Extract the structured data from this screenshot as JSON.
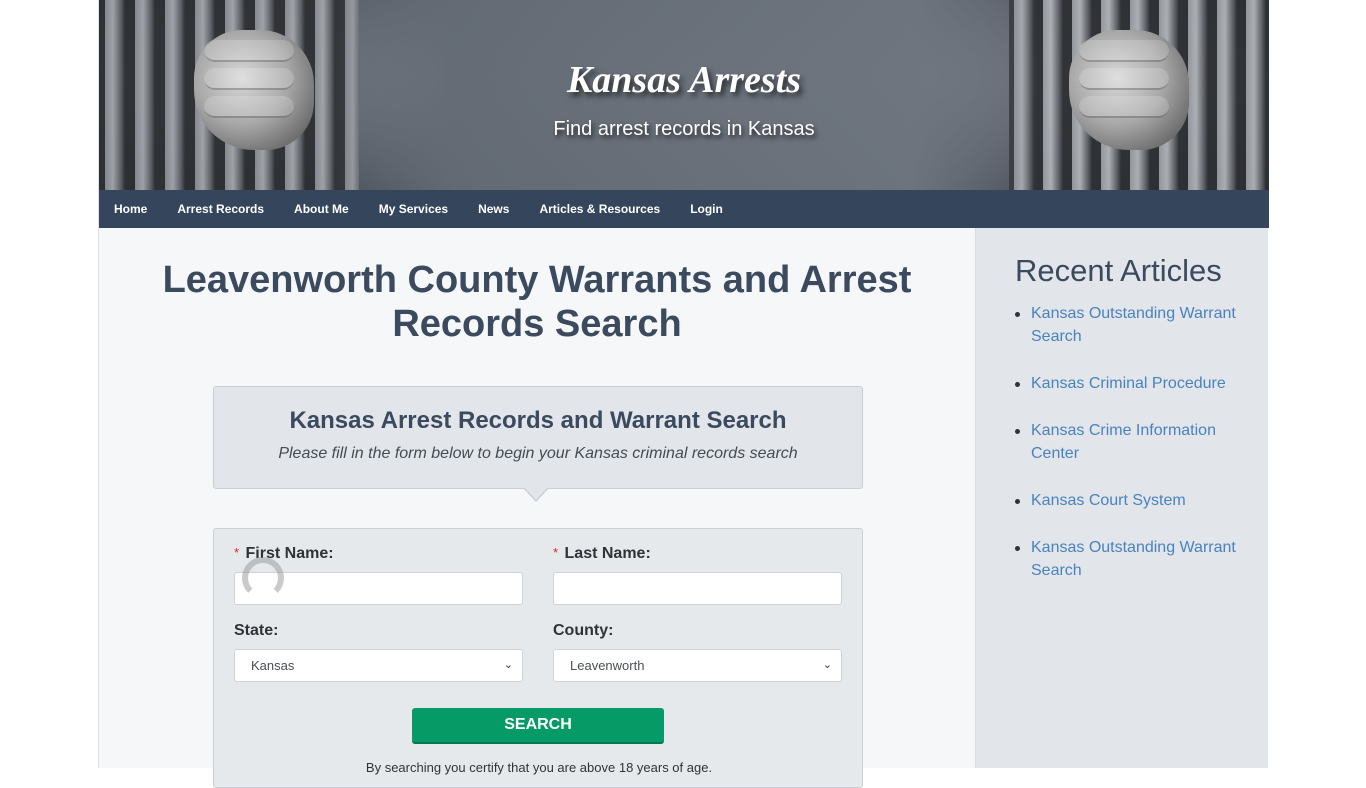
{
  "header": {
    "site_title": "Kansas Arrests",
    "tagline": "Find arrest records in Kansas"
  },
  "nav": {
    "items": [
      {
        "label": "Home"
      },
      {
        "label": "Arrest Records"
      },
      {
        "label": "About Me"
      },
      {
        "label": "My Services"
      },
      {
        "label": "News"
      },
      {
        "label": "Articles & Resources"
      },
      {
        "label": "Login"
      }
    ]
  },
  "main": {
    "page_title": "Leavenworth County Warrants and Arrest Records Search",
    "intro": {
      "heading": "Kansas Arrest Records and Warrant Search",
      "subheading": "Please fill in the form below to begin your Kansas criminal records search"
    },
    "form": {
      "required_marker": "*",
      "first_name": {
        "label": "First Name:",
        "value": "",
        "placeholder": ""
      },
      "last_name": {
        "label": "Last Name:",
        "value": "",
        "placeholder": ""
      },
      "state": {
        "label": "State:",
        "selected": "Kansas"
      },
      "county": {
        "label": "County:",
        "selected": "Leavenworth"
      },
      "search_label": "SEARCH",
      "disclaimer": "By searching you certify that you are above 18 years of age."
    }
  },
  "sidebar": {
    "title": "Recent Articles",
    "articles": [
      {
        "label": "Kansas Outstanding Warrant Search"
      },
      {
        "label": "Kansas Criminal Procedure"
      },
      {
        "label": "Kansas Crime Information Center"
      },
      {
        "label": "Kansas Court System"
      },
      {
        "label": "Kansas Outstanding Warrant Search"
      }
    ]
  },
  "colors": {
    "nav_bg": "#34455c",
    "heading": "#3b4a5e",
    "search_button": "#069a67",
    "link": "#4a82bf",
    "required": "#d62b2b"
  }
}
